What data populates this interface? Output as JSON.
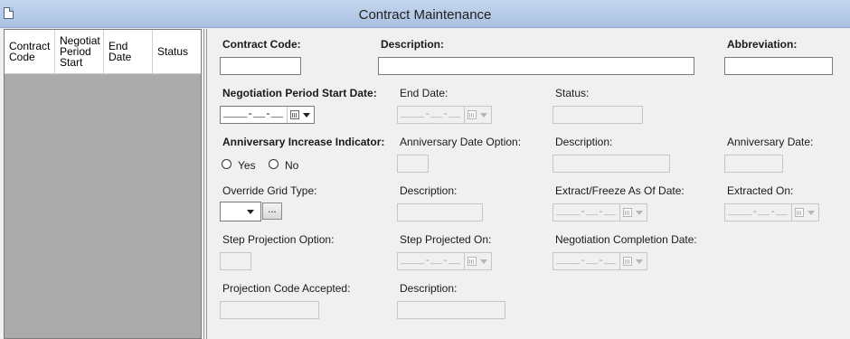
{
  "window": {
    "title": "Contract Maintenance",
    "icon": "document-icon"
  },
  "list": {
    "columns": [
      "Contract\nCode",
      "Negotiat\nPeriod\nStart",
      "End\nDate",
      "Status"
    ]
  },
  "form": {
    "contract_code": {
      "label": "Contract Code:",
      "value": ""
    },
    "description": {
      "label": "Description:",
      "value": ""
    },
    "abbreviation": {
      "label": "Abbreviation:",
      "value": ""
    },
    "neg_start_date": {
      "label": "Negotiation Period Start Date:",
      "mask": "____-__-__"
    },
    "end_date": {
      "label": "End Date:",
      "mask": "____-__-__"
    },
    "status": {
      "label": "Status:",
      "value": ""
    },
    "anniv_indicator": {
      "label": "Anniversary Increase Indicator:",
      "yes": "Yes",
      "no": "No"
    },
    "anniv_date_option": {
      "label": "Anniversary Date Option:",
      "value": ""
    },
    "anniv_description": {
      "label": "Description:",
      "value": ""
    },
    "anniv_date": {
      "label": "Anniversary Date:",
      "value": ""
    },
    "override_grid_type": {
      "label": "Override Grid Type:",
      "value": "",
      "button": "..."
    },
    "grid_description": {
      "label": "Description:",
      "value": ""
    },
    "extract_freeze": {
      "label": "Extract/Freeze As Of Date:",
      "mask": "____-__-__"
    },
    "extracted_on": {
      "label": "Extracted On:",
      "mask": "____-__-__"
    },
    "step_projection_option": {
      "label": "Step Projection Option:",
      "value": ""
    },
    "step_projected_on": {
      "label": "Step Projected On:",
      "mask": "____-__-__"
    },
    "neg_completion_date": {
      "label": "Negotiation Completion Date:",
      "mask": "____-__-__"
    },
    "projection_code_accepted": {
      "label": "Projection Code Accepted:",
      "value": ""
    },
    "projection_description": {
      "label": "Description:",
      "value": ""
    }
  }
}
